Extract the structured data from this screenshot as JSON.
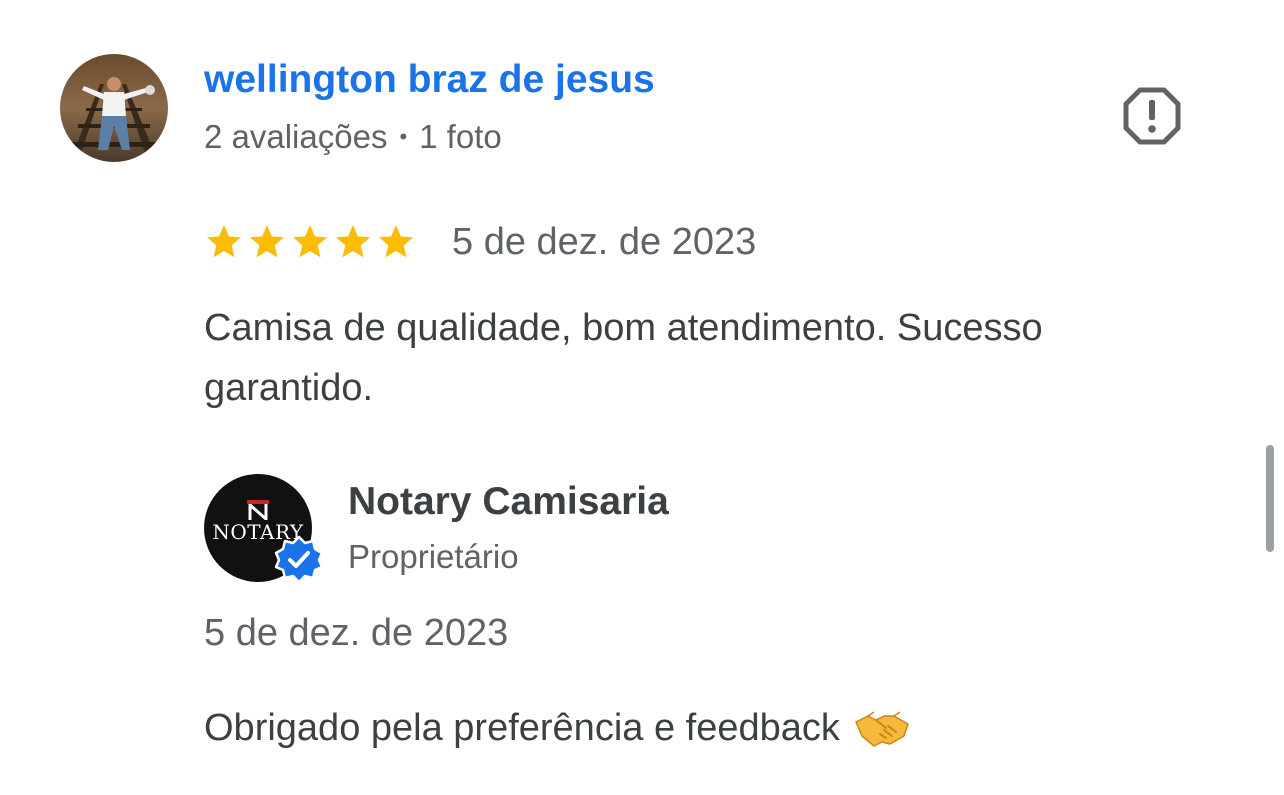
{
  "review": {
    "reviewer_name": "wellington braz de jesus",
    "reviews_count": "2 avaliações",
    "separator": "•",
    "photos_count": "1 foto",
    "rating": 5,
    "rating_max": 5,
    "date": "5 de dez. de 2023",
    "text": "Camisa de qualidade, bom atendimento. Sucesso garantido."
  },
  "owner_response": {
    "name": "Notary Camisaria",
    "logo_text": "NOTARY",
    "role": "Proprietário",
    "date": "5 de dez. de 2023",
    "text": "Obrigado pela preferência e feedback"
  },
  "icons": {
    "report": "report-flag-icon",
    "star": "star-icon",
    "verified": "verified-badge-icon",
    "handshake": "handshake-emoji-icon"
  },
  "colors": {
    "name_link": "#1a73e8",
    "star": "#fbbc04",
    "verified": "#1a73e8",
    "secondary_text": "#5f6368",
    "body_text": "#3c4043"
  }
}
